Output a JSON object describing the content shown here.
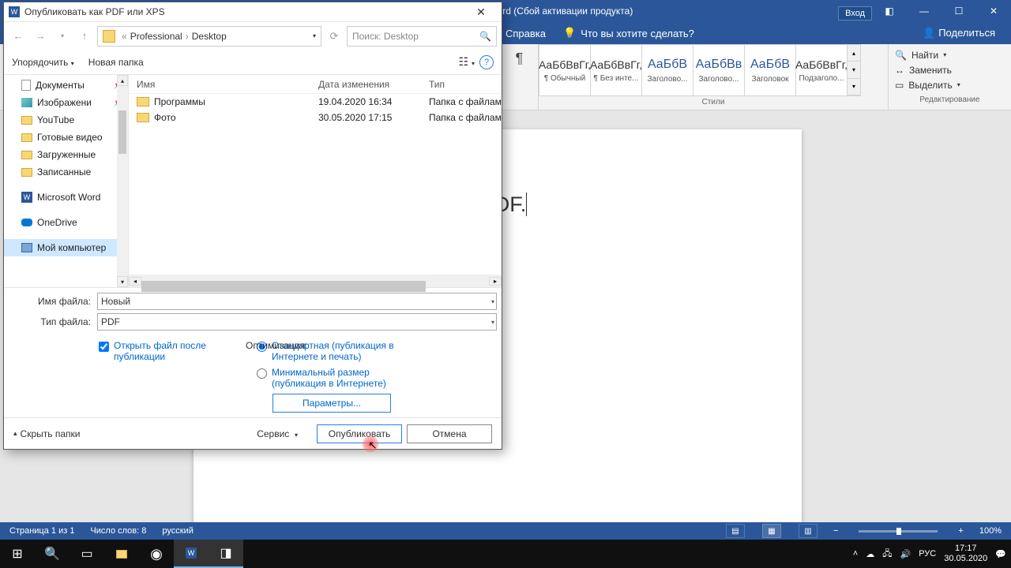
{
  "word": {
    "title_suffix": "льности] - Word (Сбой активации продукта)",
    "login": "Вход",
    "tabs": {
      "help": "Справка",
      "tell_me": "Что вы хотите сделать?"
    },
    "share": "Поделиться",
    "styles": {
      "label": "Стили",
      "items": [
        {
          "sample": "АаБбВвГг,",
          "name": "¶ Обычный"
        },
        {
          "sample": "АаБбВвГг,",
          "name": "¶ Без инте..."
        },
        {
          "sample": "АаБбВ",
          "name": "Заголово...",
          "big": true
        },
        {
          "sample": "АаБбВв",
          "name": "Заголово...",
          "big": true
        },
        {
          "sample": "АаБбВ",
          "name": "Заголовок",
          "big": true
        },
        {
          "sample": "АаБбВвГг,",
          "name": "Подзаголо..."
        }
      ]
    },
    "editing": {
      "label": "Редактирование",
      "find": "Найти",
      "replace": "Заменить",
      "select": "Выделить"
    },
    "document_text": "у сохранять документ в PDF.",
    "status": {
      "page": "Страница 1 из 1",
      "words": "Число слов: 8",
      "lang": "русский",
      "zoom": "100%"
    }
  },
  "dialog": {
    "title": "Опубликовать как PDF или XPS",
    "breadcrumb": {
      "part1": "Professional",
      "part2": "Desktop"
    },
    "search_placeholder": "Поиск: Desktop",
    "toolbar": {
      "organize": "Упорядочить",
      "new_folder": "Новая папка"
    },
    "tree": [
      {
        "name": "Документы",
        "ico": "doc",
        "pin": true
      },
      {
        "name": "Изображени",
        "ico": "img",
        "pin": true
      },
      {
        "name": "YouTube",
        "ico": "fold"
      },
      {
        "name": "Готовые видео",
        "ico": "fold"
      },
      {
        "name": "Загруженные",
        "ico": "fold"
      },
      {
        "name": "Записанные",
        "ico": "fold"
      },
      {
        "name": "",
        "spacer": true
      },
      {
        "name": "Microsoft Word",
        "ico": "word"
      },
      {
        "name": "",
        "spacer": true
      },
      {
        "name": "OneDrive",
        "ico": "onedrive"
      },
      {
        "name": "",
        "spacer": true
      },
      {
        "name": "Мой компьютер",
        "ico": "pc",
        "sel": true
      }
    ],
    "columns": {
      "name": "Имя",
      "date": "Дата изменения",
      "type": "Тип"
    },
    "rows": [
      {
        "name": "Программы",
        "date": "19.04.2020 16:34",
        "type": "Папка с файлам"
      },
      {
        "name": "Фото",
        "date": "30.05.2020 17:15",
        "type": "Папка с файлам"
      }
    ],
    "filename_label": "Имя файла:",
    "filename_value": "Новый",
    "filetype_label": "Тип файла:",
    "filetype_value": "PDF",
    "open_after": "Открыть файл после публикации",
    "optimization_label": "Оптимизация:",
    "opt_standard": "Стандартная (публикация в Интернете и печать)",
    "opt_min": "Минимальный размер (публикация в Интернете)",
    "params_btn": "Параметры...",
    "hide_folders": "Скрыть папки",
    "service": "Сервис",
    "publish": "Опубликовать",
    "cancel": "Отмена"
  },
  "taskbar": {
    "lang": "РУС",
    "time": "17:17",
    "date": "30.05.2020"
  }
}
